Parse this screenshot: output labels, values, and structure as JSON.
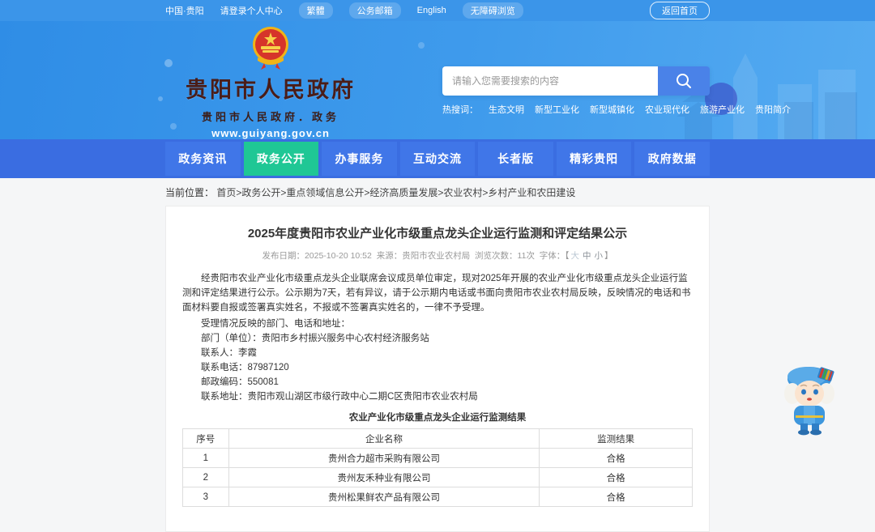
{
  "topbar": {
    "items": [
      {
        "label": "中国·贵阳",
        "pill": false
      },
      {
        "label": "请登录个人中心",
        "pill": false
      },
      {
        "label": "繁體",
        "pill": true
      },
      {
        "label": "公务邮箱",
        "pill": true
      },
      {
        "label": "English",
        "pill": false
      },
      {
        "label": "无障碍浏览",
        "pill": true
      }
    ],
    "home_button": "返回首页"
  },
  "header": {
    "site_name": "贵阳市人民政府",
    "site_subtitle": "贵阳市人民政府．政务",
    "site_url": "www.guiyang.gov.cn",
    "search": {
      "placeholder": "请输入您需要搜索的内容"
    },
    "hot_words_label": "热搜词：",
    "hot_words": [
      "生态文明",
      "新型工业化",
      "新型城镇化",
      "农业现代化",
      "旅游产业化",
      "贵阳简介"
    ]
  },
  "nav": {
    "items": [
      {
        "label": "政务资讯",
        "active": false
      },
      {
        "label": "政务公开",
        "active": true
      },
      {
        "label": "办事服务",
        "active": false
      },
      {
        "label": "互动交流",
        "active": false
      },
      {
        "label": "长者版",
        "active": false
      },
      {
        "label": "精彩贵阳",
        "active": false
      },
      {
        "label": "政府数据",
        "active": false
      }
    ]
  },
  "breadcrumb": {
    "label": "当前位置：",
    "path": "首页>政务公开>重点领域信息公开>经济高质量发展>农业农村>乡村产业和农田建设"
  },
  "article": {
    "title": "2025年度贵阳市农业产业化市级重点龙头企业运行监测和评定结果公示",
    "meta": {
      "publish_label": "发布日期：",
      "publish_date": "2025-10-20 10:52",
      "source_label": "来源：",
      "source": "贵阳市农业农村局",
      "views_label": "浏览次数：",
      "views": "11次",
      "font_label": "字体：【",
      "font_sizes": [
        "大",
        "中",
        "小"
      ],
      "font_label_end": "】"
    },
    "paragraphs": [
      "经贵阳市农业产业化市级重点龙头企业联席会议成员单位审定，现对2025年开展的农业产业化市级重点龙头企业运行监测和评定结果进行公示。公示期为7天，若有异议，请于公示期内电话或书面向贵阳市农业农村局反映，反映情况的电话和书面材料要自报或签署真实姓名，不报或不签署真实姓名的，一律不予受理。",
      "受理情况反映的部门、电话和地址：",
      "部门（单位）：贵阳市乡村振兴服务中心农村经济服务站",
      "联系人：李霞",
      "联系电话：87987120",
      "邮政编码：550081",
      "联系地址：贵阳市观山湖区市级行政中心二期C区贵阳市农业农村局"
    ],
    "table": {
      "caption": "农业产业化市级重点龙头企业运行监测结果",
      "headers": [
        "序号",
        "企业名称",
        "监测结果"
      ],
      "rows": [
        [
          "1",
          "贵州合力超市采购有限公司",
          "合格"
        ],
        [
          "2",
          "贵州友禾种业有限公司",
          "合格"
        ],
        [
          "3",
          "贵州松果鲜农产品有限公司",
          "合格"
        ]
      ]
    }
  },
  "colors": {
    "topbar_bg": "#3b95e9",
    "header_blue": "#3f9bec",
    "nav_band": "#3a6de1",
    "nav_button": "#4076e8",
    "nav_active_green": "#1fc795",
    "search_button": "#4a82e8",
    "emblem_red": "#d6342a",
    "emblem_gold": "#f0b417",
    "site_name_color": "#4a1d18",
    "page_bg": "#f5f6f7"
  }
}
